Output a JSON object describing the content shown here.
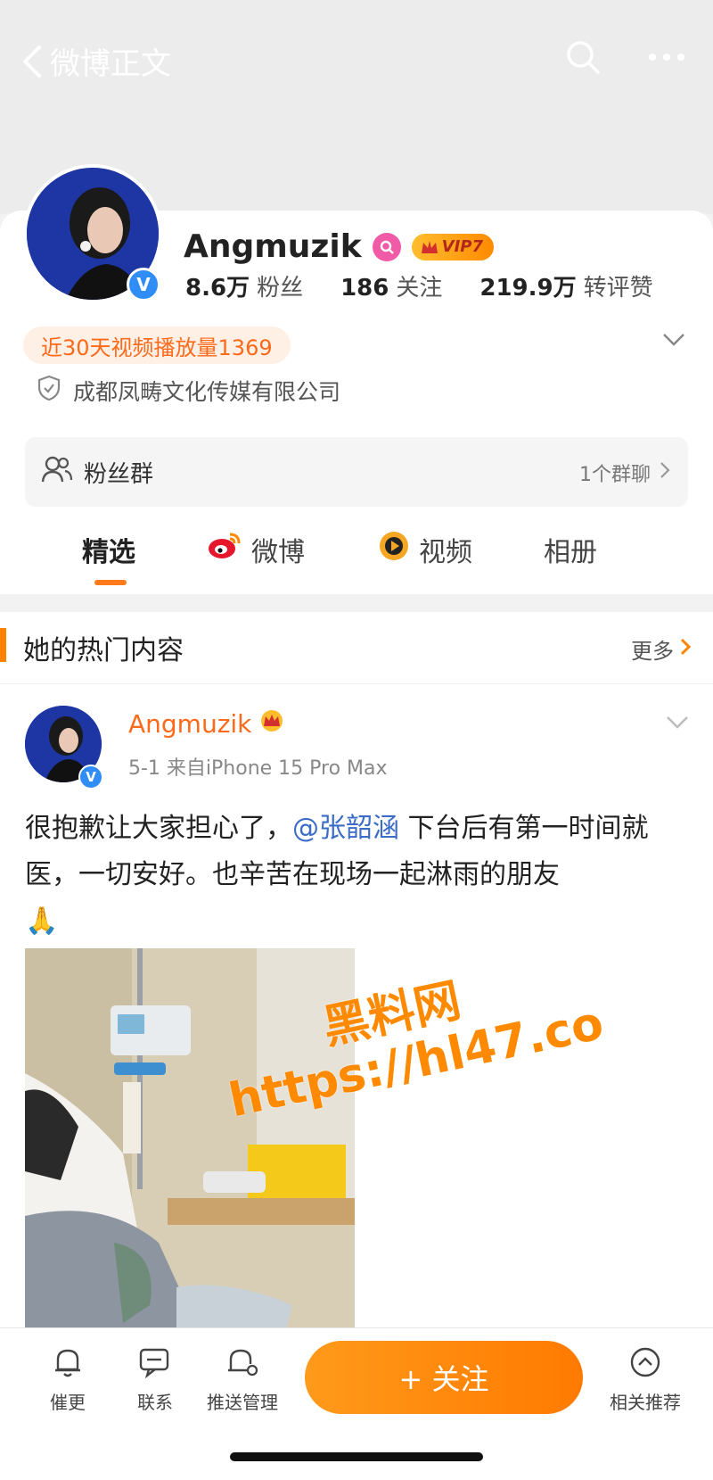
{
  "nav": {
    "back_label": "微博正文"
  },
  "profile": {
    "name": "Angmuzik",
    "vip_label": "VIP7",
    "verify_mark": "V",
    "stats": [
      {
        "value": "8.6万",
        "label": "粉丝"
      },
      {
        "value": "186",
        "label": "关注"
      },
      {
        "value": "219.9万",
        "label": "转评赞"
      }
    ],
    "play_count": "近30天视频播放量1369",
    "company": "成都凤畴文化传媒有限公司",
    "fans_group": {
      "label": "粉丝群",
      "right": "1个群聊"
    }
  },
  "tabs": [
    {
      "label": "精选",
      "active": true
    },
    {
      "label": "微博"
    },
    {
      "label": "视频"
    },
    {
      "label": "相册"
    }
  ],
  "hot": {
    "title": "她的热门内容",
    "more": "更多"
  },
  "post": {
    "name": "Angmuzik",
    "meta": "5-1  来自iPhone 15 Pro Max",
    "text_before": "很抱歉让大家担心了，",
    "mention": "@张韶涵",
    "text_after": " 下台后有第一时间就医，一切安好。也辛苦在现场一起淋雨的朋友",
    "emoji": "🙏"
  },
  "watermark": {
    "line1": "黑料网",
    "line2": "https://hl47.co"
  },
  "bottom": {
    "items": [
      "催更",
      "联系",
      "推送管理"
    ],
    "follow": "+ 关注",
    "recommend": "相关推荐"
  },
  "colors": {
    "accent": "#ff8200",
    "mention": "#3b6cc6",
    "verify": "#2f8df5"
  }
}
